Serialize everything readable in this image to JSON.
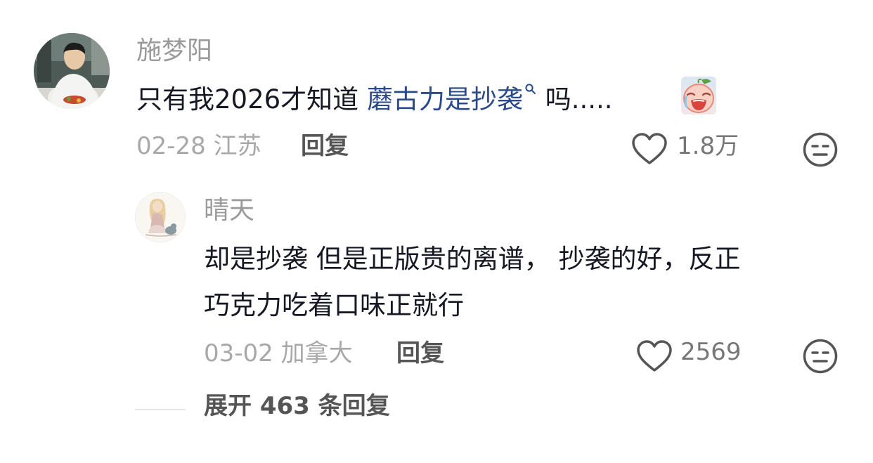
{
  "comment": {
    "username": "施梦阳",
    "text_before": "只有我2026才知道 ",
    "search_link": "蘑古力是抄袭",
    "text_after": " 吗.....",
    "emoji_icon": "crying-face-emoji-icon",
    "date": "02-28",
    "location": "江苏",
    "reply_label": "回复",
    "like_count": "1.8万"
  },
  "reply": {
    "username": "晴天",
    "text_line1": "却是抄袭 但是正版贵的离谱， 抄袭的好，反正",
    "text_line2": "巧克力吃着口味正就行",
    "date": "03-02",
    "location": "加拿大",
    "reply_label": "回复",
    "like_count": "2569"
  },
  "expand": {
    "label": "展开 463 条回复"
  },
  "colors": {
    "link": "#2b4a8c",
    "muted": "#9a9a9a",
    "text": "#161823"
  }
}
